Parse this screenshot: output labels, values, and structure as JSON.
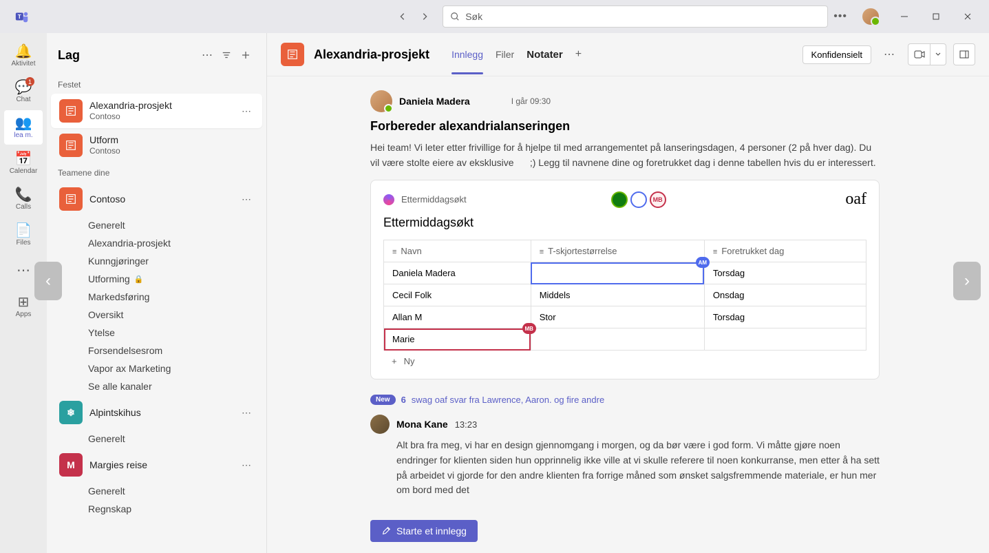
{
  "titlebar": {
    "search_placeholder": "Søk"
  },
  "rail": {
    "activity": "Aktivitet",
    "chat": "Chat",
    "teams": "lea m.",
    "calendar": "Calendar",
    "calls": "Calls",
    "files": "Files",
    "apps": "Apps",
    "chat_badge": "1"
  },
  "sidebar": {
    "title": "Lag",
    "sections": {
      "pinned": "Festet",
      "your_teams": "Teamene dine"
    },
    "pinned": [
      {
        "name": "Alexandria-prosjekt",
        "sub": "Contoso"
      },
      {
        "name": "Utform",
        "sub": "Contoso"
      }
    ],
    "teams": [
      {
        "name": "Contoso",
        "channels": [
          "Generelt",
          "Alexandria-prosjekt",
          "Kunngjøringer",
          "Utforming",
          "Markedsføring",
          "Oversikt",
          "Ytelse",
          "Forsendelsesrom",
          "Vapor ax Marketing",
          "Se alle kanaler"
        ]
      },
      {
        "name": "Alpintskihus",
        "channels": [
          "Generelt"
        ]
      },
      {
        "name": "Margies reise",
        "channels": [
          "Generelt",
          "Regnskap"
        ]
      }
    ]
  },
  "main": {
    "title": "Alexandria-prosjekt",
    "tabs": {
      "posts": "Innlegg",
      "files": "Filer",
      "notes": "Notater"
    },
    "sensitivity": "Konfidensielt"
  },
  "post": {
    "author": "Daniela Madera",
    "time": "I går 09:30",
    "title": "Forbereder alexandrialanseringen",
    "body": "Hei team! Vi leter etter frivillige for å hjelpe til med arrangementet på lanseringsdagen, 4 personer (2 på hver dag). Du vil være stolte eiere av eksklusive      ;) Legg til navnene dine og foretrukket dag i denne tabellen hvis du er interessert."
  },
  "loop": {
    "label": "Ettermiddagsøkt",
    "right_text": "oaf",
    "title": "Ettermiddagsøkt",
    "columns": [
      "Navn",
      "T-skjortestørrelse",
      "Foretrukket dag"
    ],
    "rows": [
      {
        "name": "Daniela Madera",
        "size": "",
        "day": "Torsdag"
      },
      {
        "name": "Cecil Folk",
        "size": "Middels",
        "day": "Onsdag"
      },
      {
        "name": "Allan M",
        "size": "Stor",
        "day": "Torsdag"
      },
      {
        "name": "Marie",
        "size": "",
        "day": ""
      }
    ],
    "add_row": "Ny",
    "cursor_am": "AM",
    "cursor_mb": "MB"
  },
  "replies": {
    "new": "New",
    "count": "6",
    "text": "swag oaf svar fra Lawrence, Aaron. og fire andre"
  },
  "post2": {
    "author": "Mona Kane",
    "time": "13:23",
    "body": "Alt bra fra meg, vi har en design gjennomgang i morgen, og da bør være i god form. Vi måtte gjøre noen endringer for klienten siden hun opprinnelig ikke ville at vi skulle referere til noen konkurranse, men etter å ha sett på arbeidet vi gjorde for den andre klienten fra forrige måned som ønsket salgsfremmende materiale, er hun mer om bord med det"
  },
  "compose": {
    "label": "Starte et innlegg"
  }
}
